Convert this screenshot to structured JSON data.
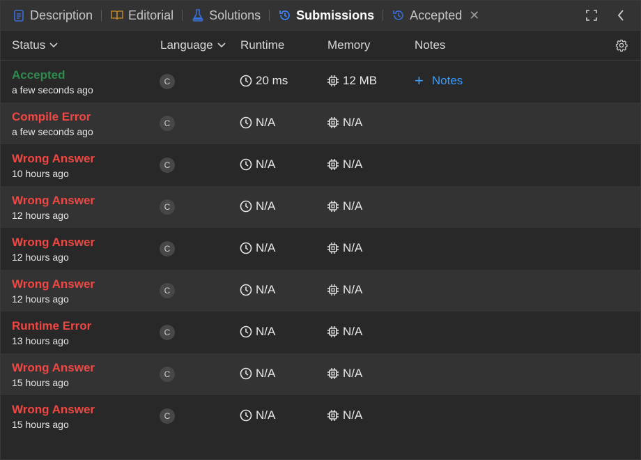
{
  "tabs": [
    {
      "id": "description",
      "label": "Description",
      "icon": "document-icon",
      "color": "#3b6fd8"
    },
    {
      "id": "editorial",
      "label": "Editorial",
      "icon": "book-icon",
      "color": "#b7822a"
    },
    {
      "id": "solutions",
      "label": "Solutions",
      "icon": "flask-icon",
      "color": "#3b6fd8"
    },
    {
      "id": "submissions",
      "label": "Submissions",
      "icon": "history-icon",
      "color": "#3b82f6",
      "active": true
    },
    {
      "id": "accepted",
      "label": "Accepted",
      "icon": "history-icon",
      "color": "#3b6fd8"
    }
  ],
  "header": {
    "status": "Status",
    "language": "Language",
    "runtime": "Runtime",
    "memory": "Memory",
    "notes": "Notes"
  },
  "rows": [
    {
      "status": "Accepted",
      "kind": "ok",
      "time": "a few seconds ago",
      "lang": "C",
      "runtime": "20 ms",
      "memory": "12 MB",
      "notes": "Notes"
    },
    {
      "status": "Compile Error",
      "kind": "bad",
      "time": "a few seconds ago",
      "lang": "C",
      "runtime": "N/A",
      "memory": "N/A"
    },
    {
      "status": "Wrong Answer",
      "kind": "bad",
      "time": "10 hours ago",
      "lang": "C",
      "runtime": "N/A",
      "memory": "N/A"
    },
    {
      "status": "Wrong Answer",
      "kind": "bad",
      "time": "12 hours ago",
      "lang": "C",
      "runtime": "N/A",
      "memory": "N/A"
    },
    {
      "status": "Wrong Answer",
      "kind": "bad",
      "time": "12 hours ago",
      "lang": "C",
      "runtime": "N/A",
      "memory": "N/A"
    },
    {
      "status": "Wrong Answer",
      "kind": "bad",
      "time": "12 hours ago",
      "lang": "C",
      "runtime": "N/A",
      "memory": "N/A"
    },
    {
      "status": "Runtime Error",
      "kind": "bad",
      "time": "13 hours ago",
      "lang": "C",
      "runtime": "N/A",
      "memory": "N/A"
    },
    {
      "status": "Wrong Answer",
      "kind": "bad",
      "time": "15 hours ago",
      "lang": "C",
      "runtime": "N/A",
      "memory": "N/A"
    },
    {
      "status": "Wrong Answer",
      "kind": "bad",
      "time": "15 hours ago",
      "lang": "C",
      "runtime": "N/A",
      "memory": "N/A"
    }
  ],
  "colors": {
    "accepted": "#2e8b4e",
    "error": "#ef4743",
    "link": "#3b9cff",
    "background": "#282828",
    "stripe": "#333333"
  }
}
